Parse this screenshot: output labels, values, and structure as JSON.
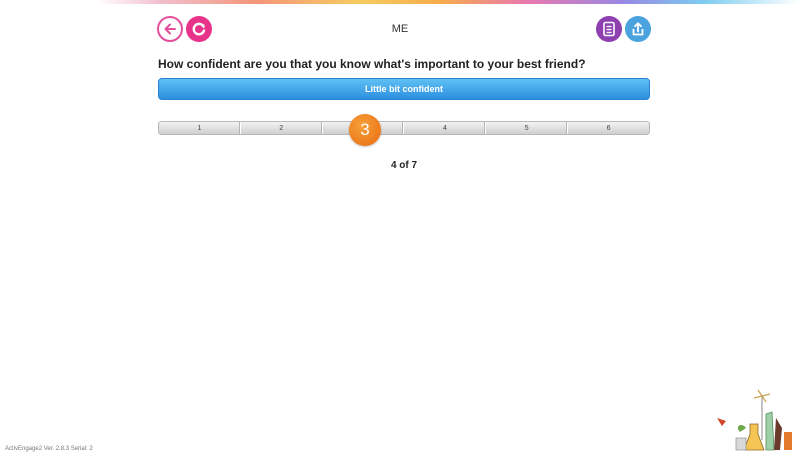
{
  "header": {
    "title": "ME",
    "icons": {
      "back": "arrow-left-icon",
      "refresh": "refresh-icon",
      "notes": "notes-icon",
      "share": "share-upload-icon"
    }
  },
  "question": {
    "text": "How confident are you that you know what's important to your best friend?",
    "selected_answer": "Little bit confident"
  },
  "scale": {
    "options": [
      "1",
      "2",
      "3",
      "4",
      "5",
      "6"
    ],
    "selected_value": "3",
    "selected_index": 2
  },
  "progress": {
    "text": "4 of 7"
  },
  "footer": {
    "version": "ActivEngage2 Ver. 2.8.3 Serial: 2"
  },
  "colors": {
    "back": "#e44f9c",
    "refresh": "#e8338b",
    "notes": "#8e3fb0",
    "share": "#4aa2df",
    "answer_bar": "#2b8fe0",
    "knob": "#e86b10"
  }
}
